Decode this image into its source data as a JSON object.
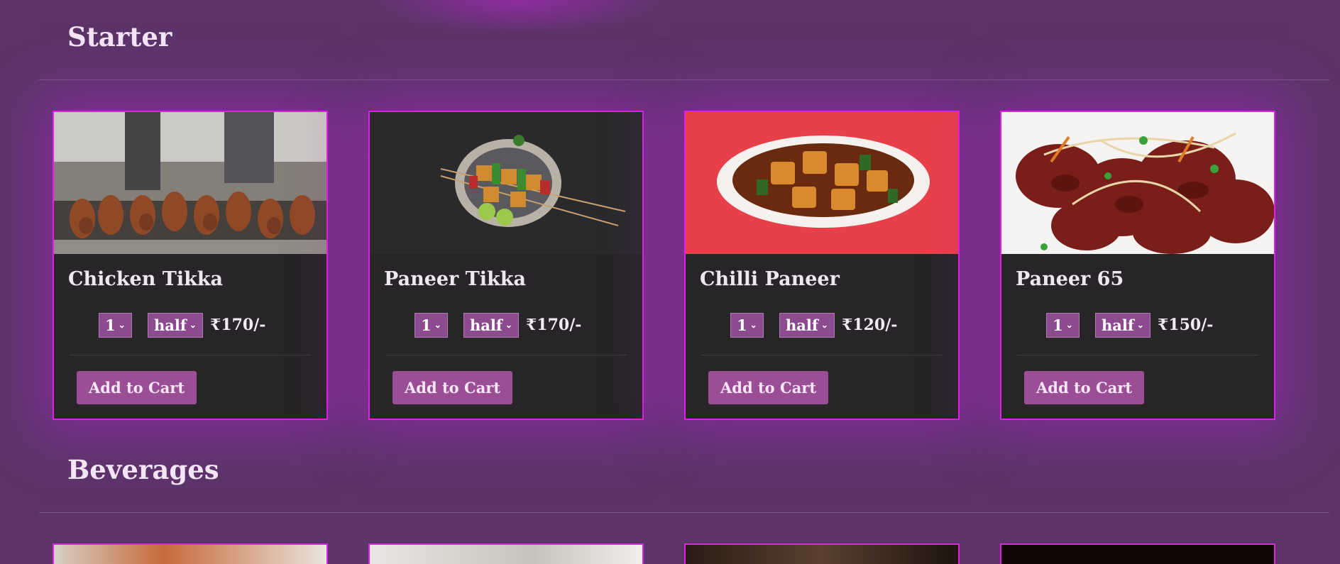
{
  "sections": [
    {
      "title": "Starter",
      "items": [
        {
          "name": "Chicken Tikka",
          "qty": "1",
          "portion": "half",
          "price": "₹170/-",
          "button": "Add to Cart"
        },
        {
          "name": "Paneer Tikka",
          "qty": "1",
          "portion": "half",
          "price": "₹170/-",
          "button": "Add to Cart"
        },
        {
          "name": "Chilli Paneer",
          "qty": "1",
          "portion": "half",
          "price": "₹120/-",
          "button": "Add to Cart"
        },
        {
          "name": "Paneer 65",
          "qty": "1",
          "portion": "half",
          "price": "₹150/-",
          "button": "Add to Cart"
        }
      ]
    },
    {
      "title": "Beverages"
    }
  ],
  "colors": {
    "background": "#5c3469",
    "card": "#272527",
    "card_border": "#e21fe8",
    "button": "#9a4e96",
    "select": "#8c4a8f"
  }
}
